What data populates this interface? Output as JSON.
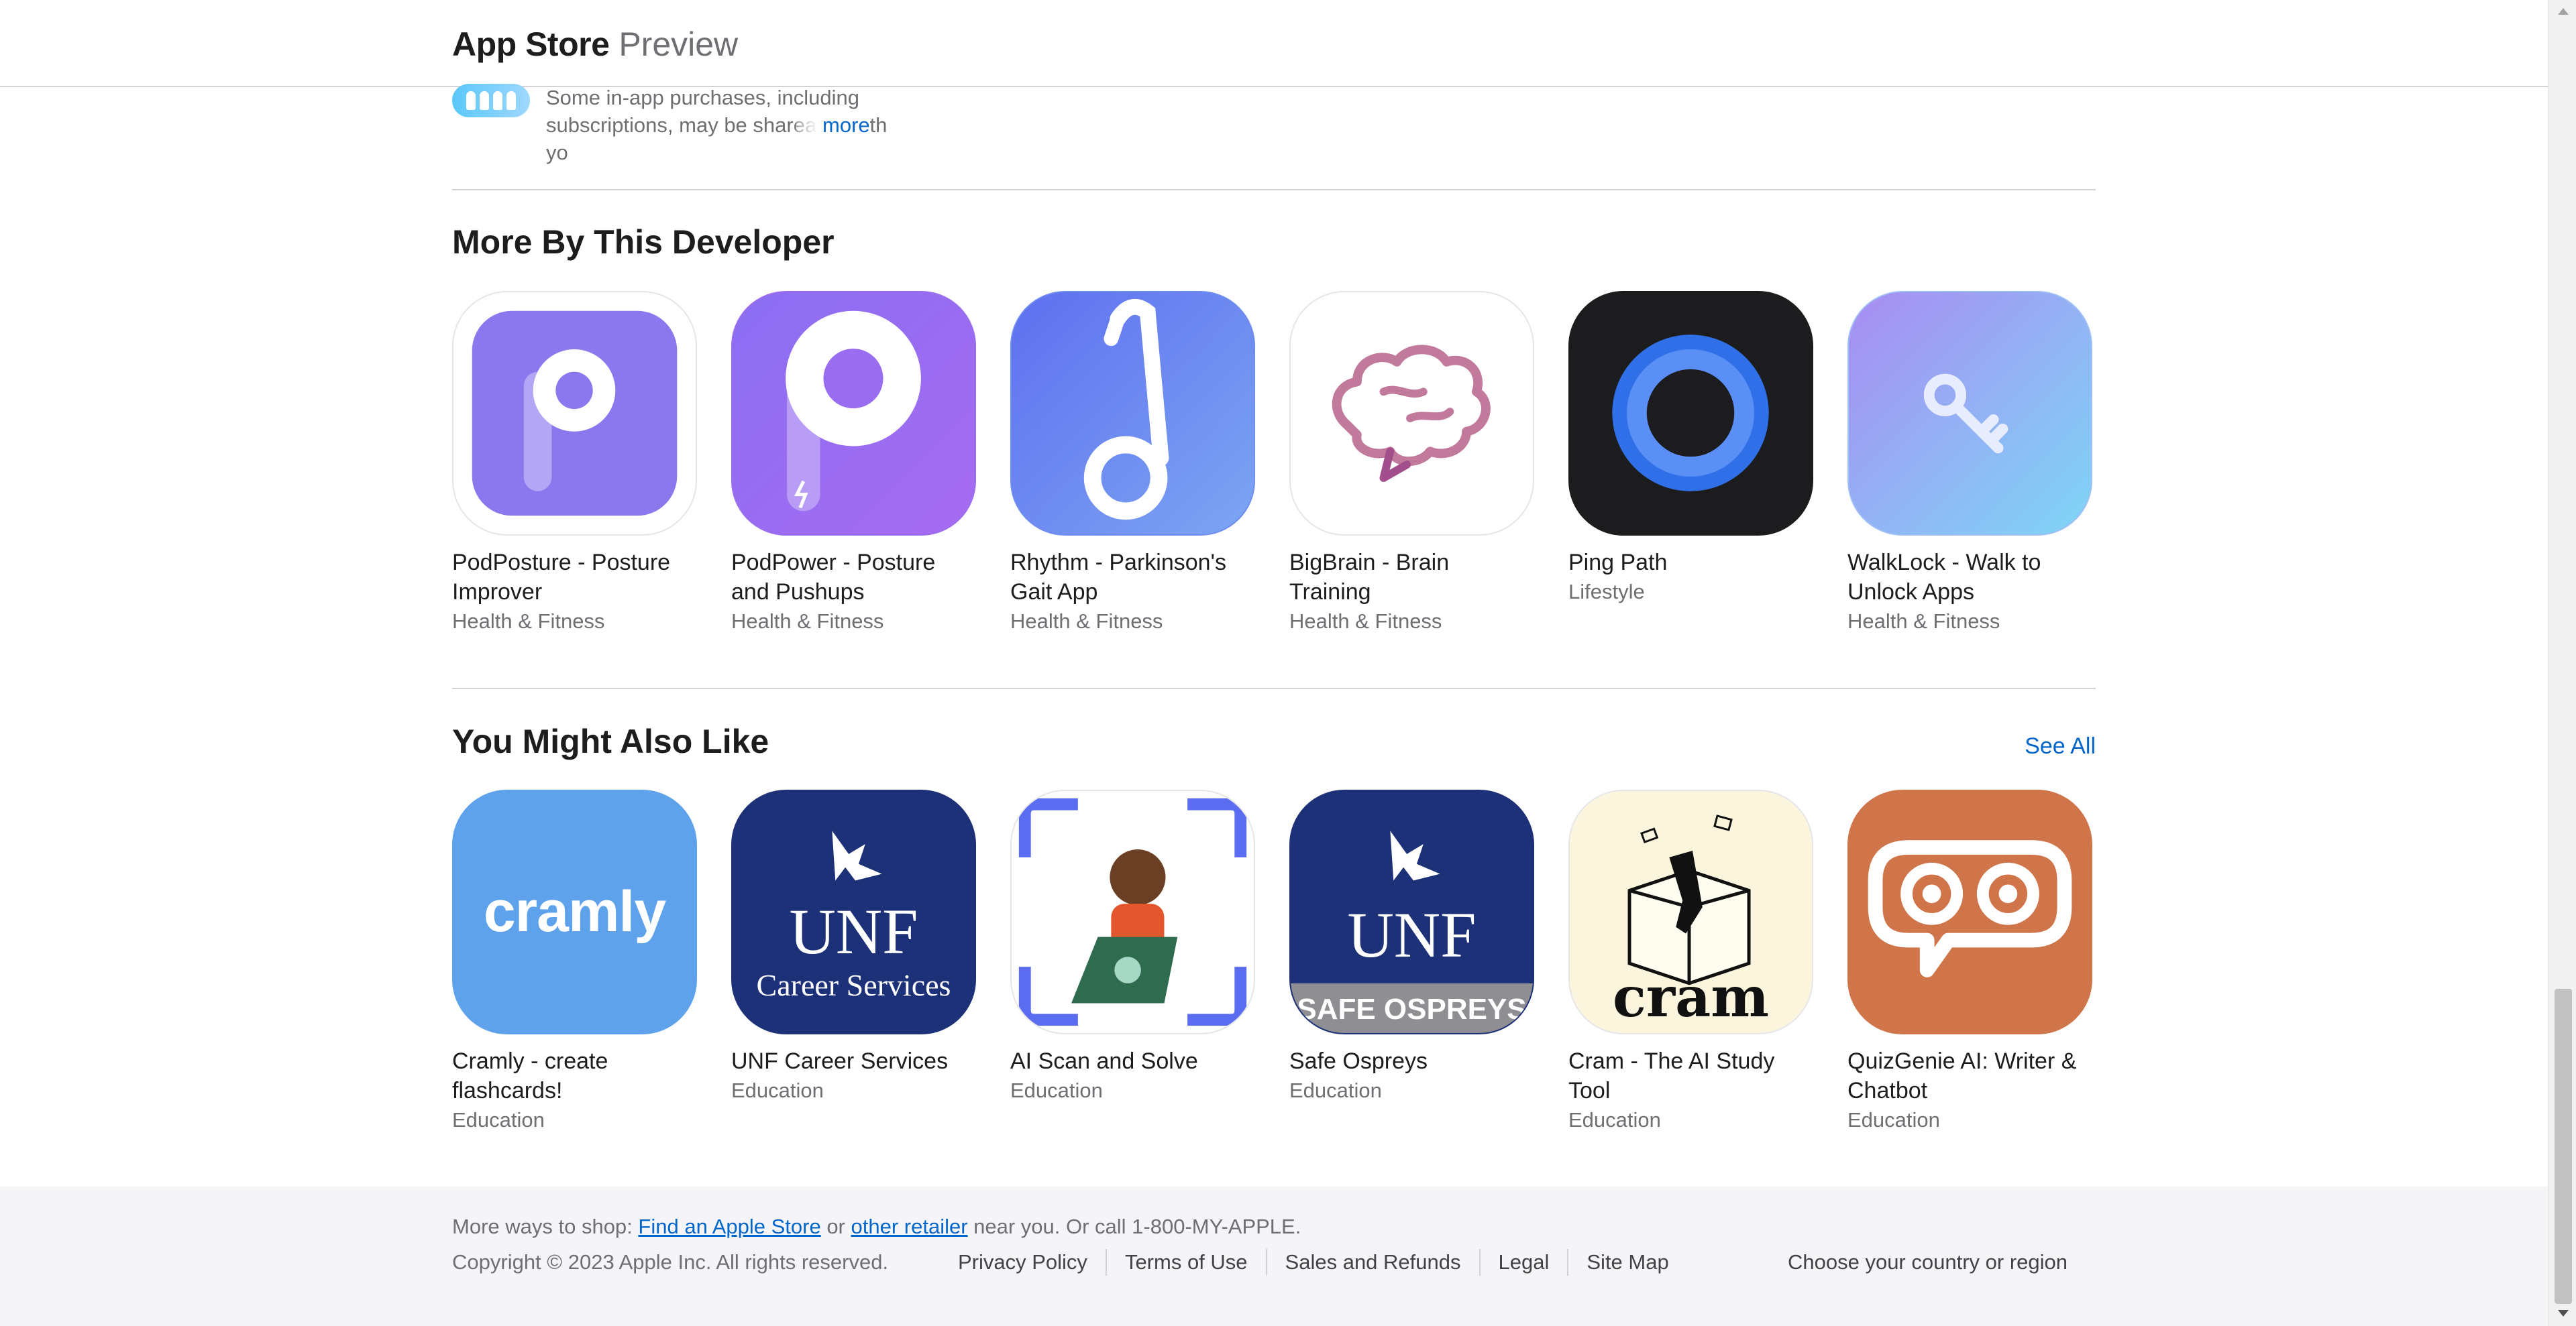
{
  "header": {
    "brand_bold": "App Store",
    "brand_light": "Preview"
  },
  "family": {
    "text": "Some in-app purchases, including subscriptions, may be shareable with yo",
    "more": "more"
  },
  "more_by_developer": {
    "title": "More By This Developer",
    "apps": [
      {
        "name": "PodPosture - Posture Improver",
        "category": "Health & Fitness",
        "icon": "podposture-icon"
      },
      {
        "name": "PodPower - Posture and Pushups",
        "category": "Health & Fitness",
        "icon": "podpower-icon"
      },
      {
        "name": "Rhythm - Parkinson's Gait App",
        "category": "Health & Fitness",
        "icon": "rhythm-icon"
      },
      {
        "name": "BigBrain - Brain Training",
        "category": "Health & Fitness",
        "icon": "bigbrain-icon"
      },
      {
        "name": "Ping Path",
        "category": "Lifestyle",
        "icon": "pingpath-icon"
      },
      {
        "name": "WalkLock - Walk to Unlock Apps",
        "category": "Health & Fitness",
        "icon": "walklock-icon"
      }
    ]
  },
  "you_might_also_like": {
    "title": "You Might Also Like",
    "see_all": "See All",
    "apps": [
      {
        "name": "Cramly - create flashcards!",
        "category": "Education",
        "icon": "cramly-icon",
        "icon_text": "cramly"
      },
      {
        "name": "UNF Career Services",
        "category": "Education",
        "icon": "unf-career-icon",
        "icon_text": "UNF",
        "icon_sub": "Career Services"
      },
      {
        "name": "AI Scan and Solve",
        "category": "Education",
        "icon": "ai-scan-icon"
      },
      {
        "name": "Safe Ospreys",
        "category": "Education",
        "icon": "safe-ospreys-icon",
        "icon_text": "UNF",
        "icon_sub": "SAFE OSPREYS"
      },
      {
        "name": "Cram - The AI Study Tool",
        "category": "Education",
        "icon": "cram-icon",
        "icon_text": "cram"
      },
      {
        "name": "QuizGenie AI: Writer & Chatbot",
        "category": "Education",
        "icon": "quizgenie-icon"
      }
    ]
  },
  "footer": {
    "ways_prefix": "More ways to shop: ",
    "find_store": "Find an Apple Store",
    "or": " or ",
    "other_retailer": "other retailer",
    "suffix": " near you. Or call 1-800-MY-APPLE.",
    "copyright": "Copyright © 2023 Apple Inc. All rights reserved.",
    "links": [
      "Privacy Policy",
      "Terms of Use",
      "Sales and Refunds",
      "Legal",
      "Site Map"
    ],
    "region": "Choose your country or region"
  },
  "colors": {
    "accent": "#0066cc",
    "text": "#1d1d1f",
    "secondary": "#6e6e73",
    "footer_bg": "#f5f5f7"
  }
}
